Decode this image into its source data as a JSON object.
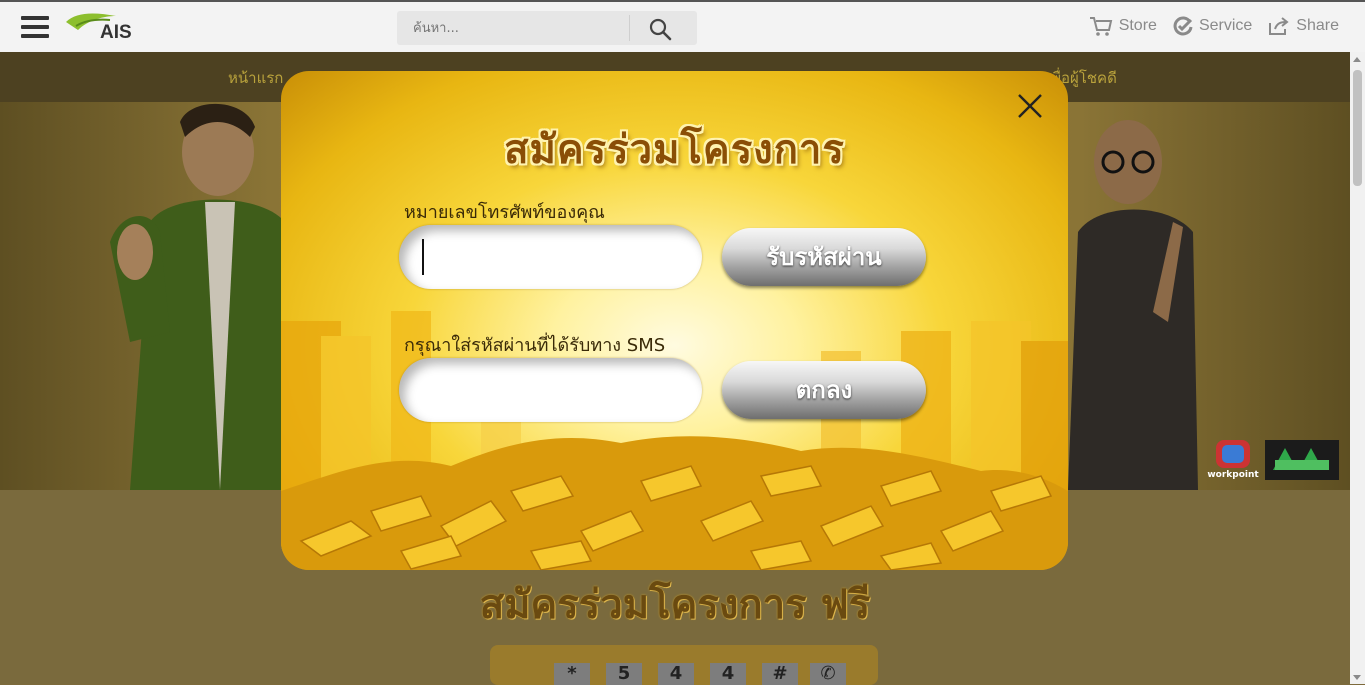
{
  "header": {
    "logo": "AIS",
    "search_placeholder": "ค้นหา...",
    "links": [
      {
        "label": "Store",
        "icon": "cart-icon"
      },
      {
        "label": "Service",
        "icon": "check-circle-icon"
      },
      {
        "label": "Share",
        "icon": "share-icon"
      }
    ]
  },
  "hero": {
    "nav": [
      "หน้าแรก",
      "เพื่อผู้โชคดี"
    ]
  },
  "below": {
    "title": "สมัครร่วมโครงการ ฟรี",
    "digits": [
      "*",
      "5",
      "4",
      "4",
      "#",
      "✆"
    ]
  },
  "modal": {
    "title": "สมัครร่วมโครงการ",
    "phone_label": "หมายเลขโทรศัพท์ของคุณ",
    "phone_value": "",
    "get_code_button": "รับรหัสผ่าน",
    "code_label": "กรุณาใส่รหัสผ่านที่ได้รับทาง SMS",
    "code_value": "",
    "confirm_button": "ตกลง"
  },
  "badges": [
    "workpoint"
  ],
  "colors": {
    "modal_gold": "#f8d63a",
    "title_brown": "#8a4e06",
    "button_gray": "#9e9e9e",
    "overlay": "#7d6a3b"
  }
}
